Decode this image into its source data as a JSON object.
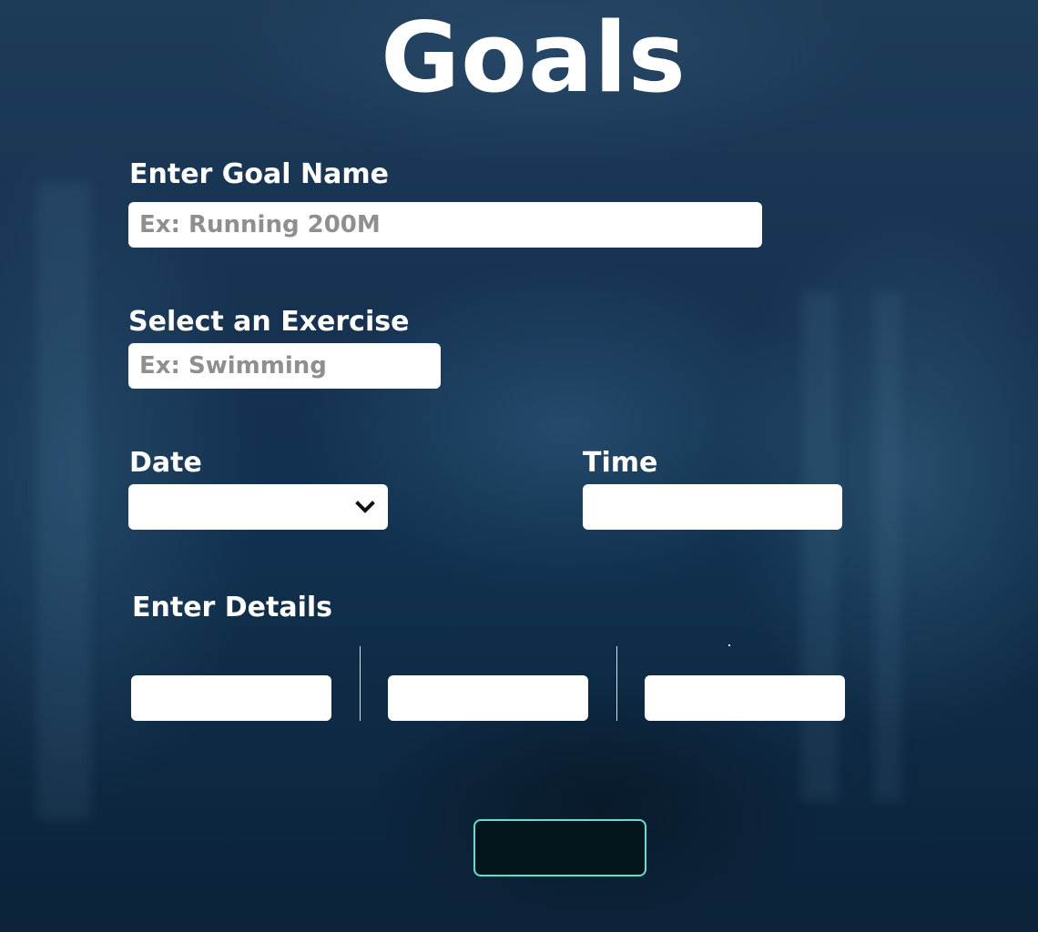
{
  "page": {
    "title": "Goals"
  },
  "form": {
    "goal_name": {
      "label": "Enter Goal Name",
      "placeholder": "Ex: Running 200M",
      "value": ""
    },
    "exercise": {
      "label": "Select an Exercise",
      "placeholder": "Ex: Swimming",
      "value": ""
    },
    "date": {
      "label": "Date",
      "selected": ""
    },
    "time": {
      "label": "Time",
      "value": ""
    },
    "details": {
      "label": "Enter Details",
      "fields": [
        {
          "value": ""
        },
        {
          "value": ""
        },
        {
          "value": ""
        }
      ]
    },
    "submit": {
      "label": ""
    }
  },
  "icons": {
    "date_dropdown": "chevron-down-icon"
  },
  "colors": {
    "background": "#153250",
    "field_background": "#ffffff",
    "placeholder": "#8f8f8f",
    "button_background": "#04161b",
    "button_border": "#62e0cf",
    "text": "#ffffff"
  }
}
